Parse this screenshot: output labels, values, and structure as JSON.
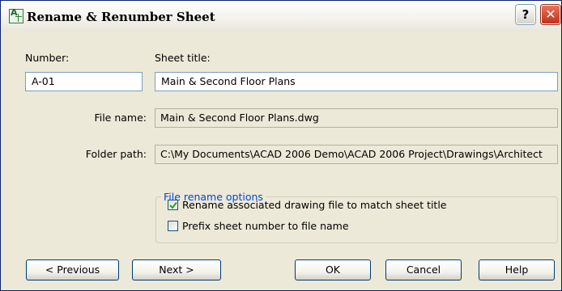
{
  "window": {
    "title": "Rename & Renumber Sheet",
    "icons": {
      "app": "sheet-set-icon",
      "help": "help-icon",
      "close": "close-icon"
    },
    "help_glyph": "?",
    "close_glyph": "✕"
  },
  "form": {
    "number_label": "Number:",
    "number_value": "A-01",
    "sheet_title_label": "Sheet title:",
    "sheet_title_value": "Main & Second Floor Plans",
    "file_name_label": "File name:",
    "file_name_value": "Main & Second Floor Plans.dwg",
    "folder_path_label": "Folder path:",
    "folder_path_value": "C:\\My Documents\\ACAD 2006 Demo\\ACAD 2006 Project\\Drawings\\Architect"
  },
  "rename_options": {
    "legend": "File rename options",
    "rename_drawing_label": "Rename associated drawing file to match sheet title",
    "rename_drawing_checked": true,
    "prefix_number_label": "Prefix sheet number to file name",
    "prefix_number_checked": false
  },
  "buttons": {
    "previous": "< Previous",
    "next": "Next >",
    "ok": "OK",
    "cancel": "Cancel",
    "help": "Help"
  },
  "colors": {
    "dialog_bg": "#ece9d8",
    "group_legend": "#0046d5",
    "close_button": "#c33119",
    "checkmark": "#21a121"
  }
}
